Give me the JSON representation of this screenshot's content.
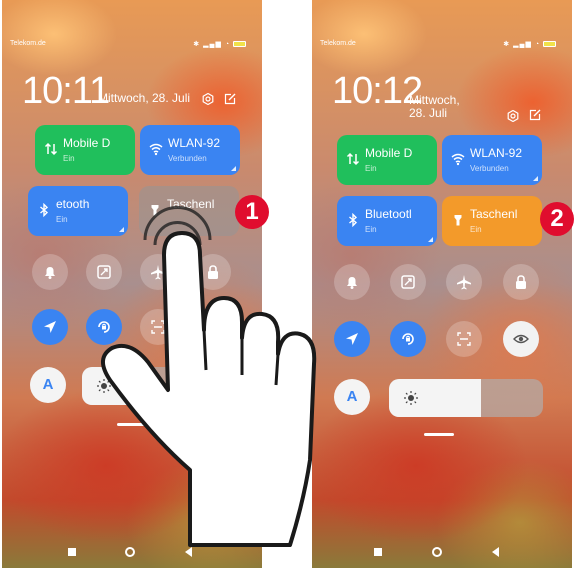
{
  "left_phone": {
    "status": {
      "carrier": "Telekom.de"
    },
    "time": "10:11",
    "date": "Mittwoch, 28. Juli",
    "tiles": [
      {
        "title": "Mobile D",
        "subtitle": "Ein",
        "icon": "mobile-data-icon",
        "color": "#20bf5c"
      },
      {
        "title": "WLAN-92",
        "subtitle": "Verbunden",
        "icon": "wifi-icon",
        "color": "#3a84f2"
      },
      {
        "title": "etooth",
        "subtitle": "Ein",
        "icon": "bluetooth-icon",
        "color": "#3a84f2"
      },
      {
        "title": "Taschenl",
        "subtitle": "",
        "icon": "flashlight-icon",
        "state": "off"
      }
    ],
    "toggles_row1": [
      "bell-icon",
      "screenshot-icon",
      "airplane-icon",
      "lock-icon"
    ],
    "toggles_row2": [
      "location-icon",
      "rotation-lock-icon",
      "scan-icon",
      "eye-icon"
    ],
    "auto_brightness_label": "A",
    "brightness_level": 0.45
  },
  "right_phone": {
    "status": {
      "carrier": "Telekom.de"
    },
    "time": "10:12",
    "date": "Mittwoch, 28. Juli",
    "tiles": [
      {
        "title": "Mobile D",
        "subtitle": "Ein",
        "icon": "mobile-data-icon",
        "color": "#20bf5c"
      },
      {
        "title": "WLAN-92",
        "subtitle": "Verbunden",
        "icon": "wifi-icon",
        "color": "#3a84f2"
      },
      {
        "title": "Bluetootl",
        "subtitle": "Ein",
        "icon": "bluetooth-icon",
        "color": "#3a84f2"
      },
      {
        "title": "Taschenl",
        "subtitle": "Ein",
        "icon": "flashlight-icon",
        "state": "on",
        "color": "#f39a2a"
      }
    ],
    "toggles_row1": [
      "bell-icon",
      "screenshot-icon",
      "airplane-icon",
      "lock-icon"
    ],
    "toggles_row2": [
      "location-icon",
      "rotation-lock-icon",
      "scan-icon",
      "eye-icon"
    ],
    "auto_brightness_label": "A",
    "brightness_level": 0.6
  },
  "steps": {
    "first": "1",
    "second": "2"
  },
  "colors": {
    "step_badge": "#e00d2e",
    "tile_green": "#20bf5c",
    "tile_blue": "#3a84f2",
    "tile_orange": "#f39a2a"
  }
}
